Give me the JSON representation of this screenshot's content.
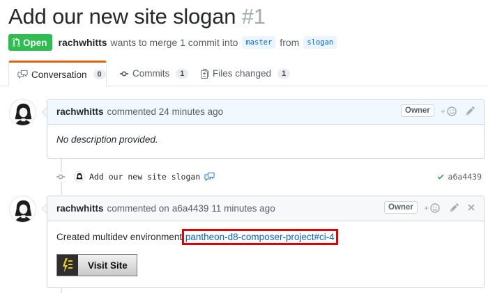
{
  "pr": {
    "title": "Add our new site slogan",
    "number": "#1",
    "state": "Open",
    "author": "rachwhitts",
    "merge_text": "wants to merge 1 commit into",
    "base_branch": "master",
    "from_text": "from",
    "head_branch": "slogan"
  },
  "tabs": [
    {
      "label": "Conversation",
      "count": "0",
      "icon": "comment-discussion-icon"
    },
    {
      "label": "Commits",
      "count": "1",
      "icon": "git-commit-icon"
    },
    {
      "label": "Files changed",
      "count": "1",
      "icon": "file-diff-icon"
    }
  ],
  "comment1": {
    "author": "rachwhitts",
    "action": "commented 24 minutes ago",
    "badge": "Owner",
    "body": "No description provided."
  },
  "commit": {
    "message": "Add our new site slogan",
    "sha": "a6a4439",
    "status": "success"
  },
  "comment2": {
    "author": "rachwhitts",
    "action_prefix": "commented on",
    "sha": "a6a4439",
    "action_suffix": "11 minutes ago",
    "badge": "Owner",
    "body_prefix": "Created multidev environment",
    "link": "pantheon-d8-composer-project#ci-4",
    "body_suffix": ".",
    "button": "Visit Site"
  },
  "colors": {
    "open": "#2cbe4e",
    "link": "#0366d6",
    "highlight": "#e60000",
    "tab_accent": "#e36209"
  }
}
